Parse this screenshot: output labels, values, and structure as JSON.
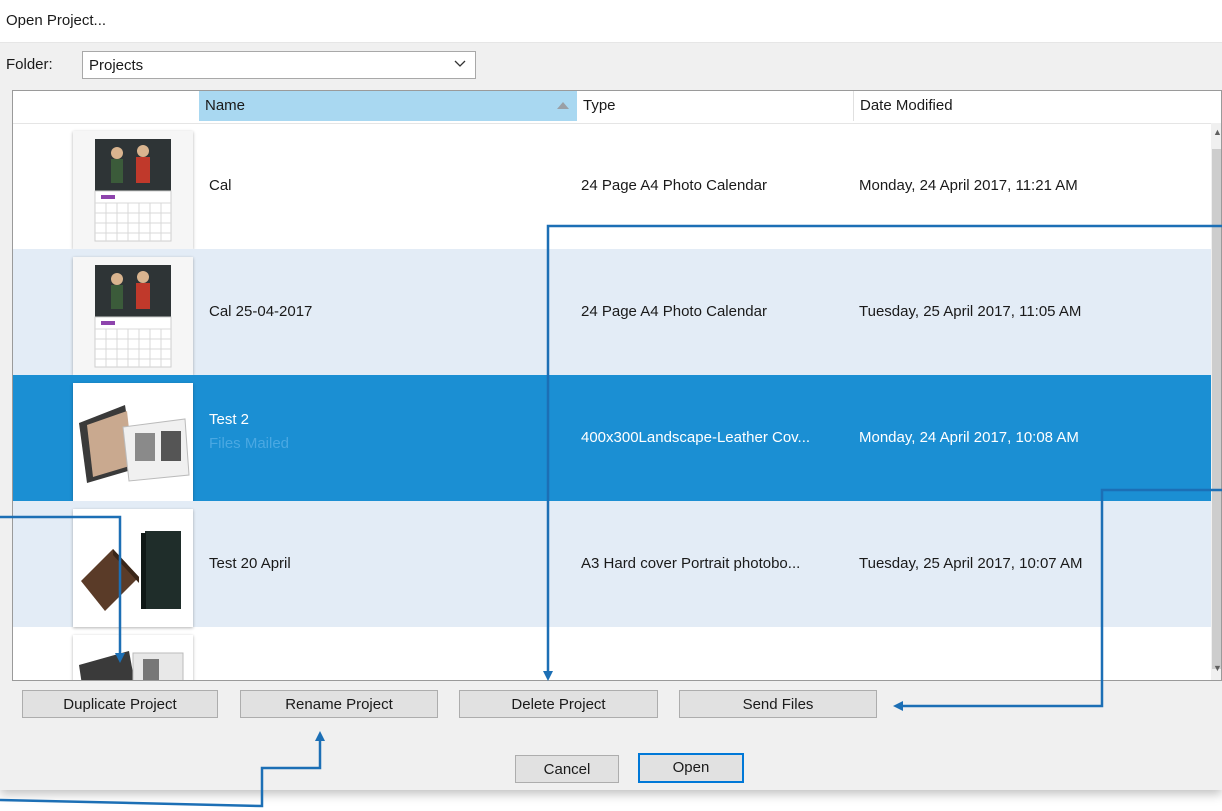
{
  "dialog": {
    "title": "Open Project...",
    "folder_label": "Folder:",
    "folder_value": "Projects"
  },
  "columns": {
    "name": "Name",
    "type": "Type",
    "date": "Date Modified"
  },
  "rows": [
    {
      "name": "Cal",
      "sub": "",
      "type": "24 Page A4 Photo Calendar",
      "date": "Monday, 24 April 2017, 11:21 AM",
      "thumb": "calendar-thumbnail"
    },
    {
      "name": "Cal 25-04-2017",
      "sub": "",
      "type": "24 Page A4 Photo Calendar",
      "date": "Tuesday, 25 April 2017, 11:05 AM",
      "thumb": "calendar-thumbnail"
    },
    {
      "name": "Test 2",
      "sub": "Files Mailed",
      "type": "400x300Landscape-Leather Cov...",
      "date": "Monday, 24 April 2017, 10:08 AM",
      "thumb": "photobook-thumbnail"
    },
    {
      "name": "Test 20 April",
      "sub": "",
      "type": "A3 Hard cover Portrait photobo...",
      "date": "Tuesday, 25 April 2017, 10:07 AM",
      "thumb": "hardcover-thumbnail"
    }
  ],
  "buttons": {
    "duplicate": "Duplicate Project",
    "rename": "Rename Project",
    "delete": "Delete Project",
    "send": "Send Files",
    "cancel": "Cancel",
    "open": "Open"
  },
  "colors": {
    "selection": "#1b8fd3",
    "alt_row": "#e3ecf6",
    "name_header": "#a9d8f1",
    "callout_line": "#1c6fb5"
  }
}
